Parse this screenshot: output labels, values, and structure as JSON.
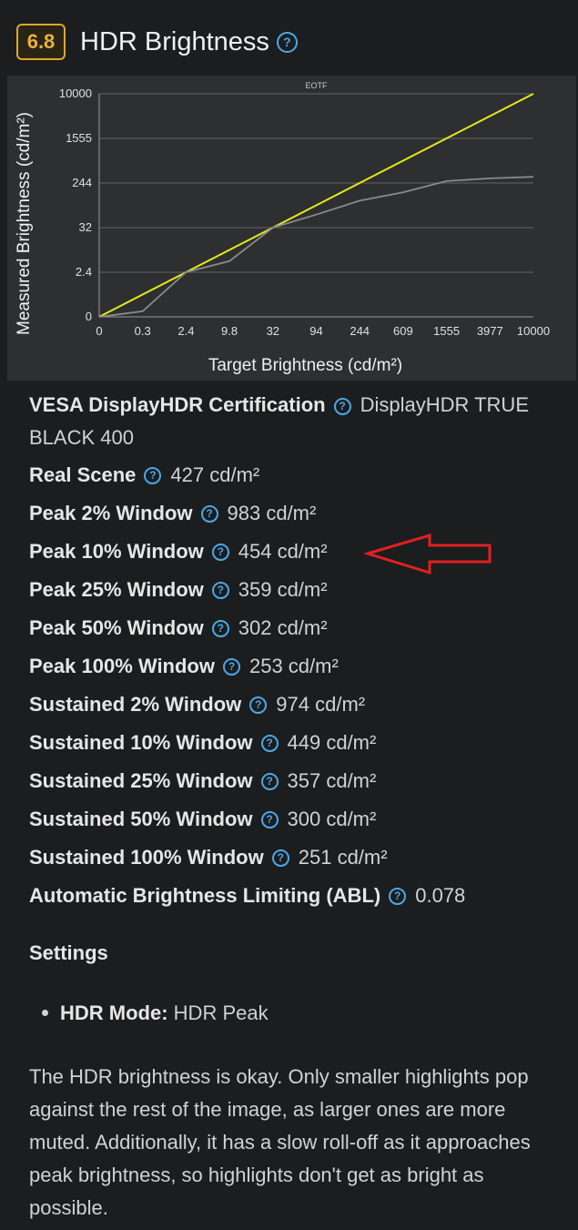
{
  "header": {
    "score": "6.8",
    "title": "HDR Brightness",
    "help_glyph": "?"
  },
  "chart_data": {
    "type": "line",
    "title": "EOTF",
    "xlabel": "Target Brightness (cd/m²)",
    "ylabel": "Measured Brightness (cd/m²)",
    "x_ticks": [
      "0",
      "0.3",
      "2.4",
      "9.8",
      "32",
      "94",
      "244",
      "609",
      "1555",
      "3977",
      "10000"
    ],
    "y_ticks": [
      "0",
      "2.4",
      "32",
      "244",
      "1555",
      "10000"
    ],
    "grid": "horizontal",
    "series": [
      {
        "color": "#e6e61e",
        "x": [
          0,
          10000
        ],
        "y": [
          0,
          10000
        ]
      },
      {
        "color": "#8a8a8a",
        "x": [
          0,
          0.3,
          2.4,
          9.8,
          32,
          94,
          244,
          609,
          1555,
          3977,
          10000
        ],
        "y": [
          0,
          0.3,
          2.4,
          9.8,
          32,
          94,
          160,
          200,
          300,
          380,
          427
        ]
      }
    ]
  },
  "specs": [
    {
      "label": "VESA DisplayHDR Certification",
      "value": "DisplayHDR TRUE BLACK 400"
    },
    {
      "label": "Real Scene",
      "value": "427 cd/m²"
    },
    {
      "label": "Peak 2% Window",
      "value": "983 cd/m²"
    },
    {
      "label": "Peak 10% Window",
      "value": "454 cd/m²"
    },
    {
      "label": "Peak 25% Window",
      "value": "359 cd/m²"
    },
    {
      "label": "Peak 50% Window",
      "value": "302 cd/m²"
    },
    {
      "label": "Peak 100% Window",
      "value": "253 cd/m²"
    },
    {
      "label": "Sustained 2% Window",
      "value": "974 cd/m²"
    },
    {
      "label": "Sustained 10% Window",
      "value": "449 cd/m²"
    },
    {
      "label": "Sustained 25% Window",
      "value": "357 cd/m²"
    },
    {
      "label": "Sustained 50% Window",
      "value": "300 cd/m²"
    },
    {
      "label": "Sustained 100% Window",
      "value": "251 cd/m²"
    },
    {
      "label": "Automatic Brightness Limiting (ABL)",
      "value": "0.078"
    }
  ],
  "settings": {
    "heading": "Settings",
    "items": [
      {
        "key": "HDR Mode:",
        "value": "HDR Peak"
      }
    ]
  },
  "description": "The HDR brightness is okay. Only smaller highlights pop against the rest of the image, as larger ones are more muted. Additionally, it has a slow roll-off as it approaches peak brightness, so highlights don't get as bright as possible.",
  "annotation": {
    "color": "#e02020",
    "icon": "left-arrow-icon"
  }
}
